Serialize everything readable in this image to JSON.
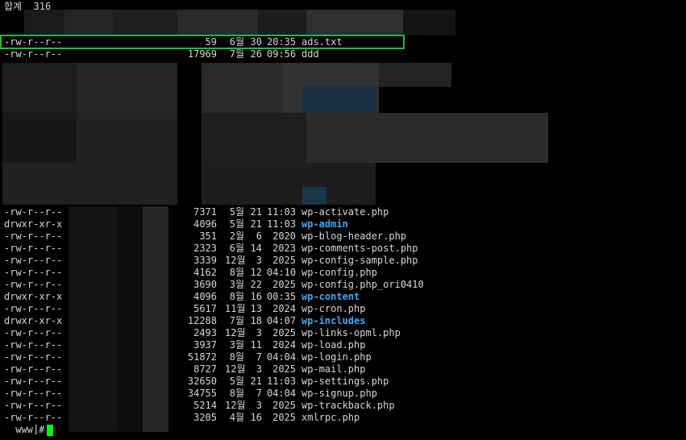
{
  "header": {
    "label": "합계",
    "value": "316"
  },
  "featured_rows": [
    {
      "perm": "-rw-r--r--",
      "size": "59",
      "month": "6월",
      "day": "30",
      "time": "20:35",
      "name": "ads.txt",
      "dir": false
    },
    {
      "perm": "-rw-r--r--",
      "size": "17969",
      "month": "7월",
      "day": "26",
      "time": "09:56",
      "name": "ddd",
      "dir": false
    }
  ],
  "rows": [
    {
      "perm": "-rw-r--r--",
      "size": "7371",
      "month": "5월",
      "day": "21",
      "time": "11:03",
      "name": "wp-activate.php",
      "dir": false
    },
    {
      "perm": "drwxr-xr-x",
      "size": "4096",
      "month": "5월",
      "day": "21",
      "time": "11:03",
      "name": "wp-admin",
      "dir": true
    },
    {
      "perm": "-rw-r--r--",
      "size": "351",
      "month": "2월",
      "day": "6",
      "time": "2020",
      "name": "wp-blog-header.php",
      "dir": false
    },
    {
      "perm": "-rw-r--r--",
      "size": "2323",
      "month": "6월",
      "day": "14",
      "time": "2023",
      "name": "wp-comments-post.php",
      "dir": false
    },
    {
      "perm": "-rw-r--r--",
      "size": "3339",
      "month": "12월",
      "day": "3",
      "time": "2025",
      "name": "wp-config-sample.php",
      "dir": false
    },
    {
      "perm": "-rw-r--r--",
      "size": "4162",
      "month": "8월",
      "day": "12",
      "time": "04:10",
      "name": "wp-config.php",
      "dir": false
    },
    {
      "perm": "-rw-r--r--",
      "size": "3690",
      "month": "3월",
      "day": "22",
      "time": "2025",
      "name": "wp-config.php_ori0410",
      "dir": false
    },
    {
      "perm": "drwxr-xr-x",
      "size": "4096",
      "month": "8월",
      "day": "16",
      "time": "00:35",
      "name": "wp-content",
      "dir": true
    },
    {
      "perm": "-rw-r--r--",
      "size": "5617",
      "month": "11월",
      "day": "13",
      "time": "2024",
      "name": "wp-cron.php",
      "dir": false
    },
    {
      "perm": "drwxr-xr-x",
      "size": "12288",
      "month": "7월",
      "day": "18",
      "time": "04:07",
      "name": "wp-includes",
      "dir": true
    },
    {
      "perm": "-rw-r--r--",
      "size": "2493",
      "month": "12월",
      "day": "3",
      "time": "2025",
      "name": "wp-links-opml.php",
      "dir": false
    },
    {
      "perm": "-rw-r--r--",
      "size": "3937",
      "month": "3월",
      "day": "11",
      "time": "2024",
      "name": "wp-load.php",
      "dir": false
    },
    {
      "perm": "-rw-r--r--",
      "size": "51872",
      "month": "8월",
      "day": "7",
      "time": "04:04",
      "name": "wp-login.php",
      "dir": false
    },
    {
      "perm": "-rw-r--r--",
      "size": "8727",
      "month": "12월",
      "day": "3",
      "time": "2025",
      "name": "wp-mail.php",
      "dir": false
    },
    {
      "perm": "-rw-r--r--",
      "size": "32650",
      "month": "5월",
      "day": "21",
      "time": "11:03",
      "name": "wp-settings.php",
      "dir": false
    },
    {
      "perm": "-rw-r--r--",
      "size": "34755",
      "month": "8월",
      "day": "7",
      "time": "04:04",
      "name": "wp-signup.php",
      "dir": false
    },
    {
      "perm": "-rw-r--r--",
      "size": "5214",
      "month": "12월",
      "day": "3",
      "time": "2025",
      "name": "wp-trackback.php",
      "dir": false
    },
    {
      "perm": "-rw-r--r--",
      "size": "3205",
      "month": "4월",
      "day": "16",
      "time": "2025",
      "name": "xmlrpc.php",
      "dir": false
    }
  ],
  "prompt": {
    "text": " www]#"
  },
  "colors": {
    "background": "#000000",
    "text": "#d6d6d6",
    "directory": "#3fa9f5",
    "highlight_border": "#29b34a",
    "cursor": "#00ff00"
  }
}
